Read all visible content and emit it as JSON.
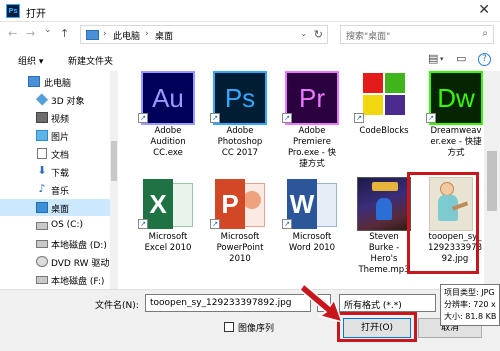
{
  "window": {
    "title": "打开",
    "app_icon_text": "Ps"
  },
  "nav": {
    "back": "←",
    "forward": "→",
    "recent": "⌄",
    "up": "↑",
    "crumbs": [
      "此电脑",
      "桌面"
    ],
    "search_placeholder": "搜索\"桌面\""
  },
  "toolbar": {
    "organize": "组织 ▾",
    "new_folder": "新建文件夹"
  },
  "sidebar": {
    "items": [
      {
        "label": "此电脑",
        "icon": "pc-icon"
      },
      {
        "label": "3D 对象",
        "icon": "cube-icon"
      },
      {
        "label": "视频",
        "icon": "video-icon"
      },
      {
        "label": "图片",
        "icon": "picture-icon"
      },
      {
        "label": "文档",
        "icon": "document-icon"
      },
      {
        "label": "下载",
        "icon": "download-icon"
      },
      {
        "label": "音乐",
        "icon": "music-icon"
      },
      {
        "label": "桌面",
        "icon": "desktop-icon"
      },
      {
        "label": "OS (C:)",
        "icon": "drive-icon"
      },
      {
        "label": "本地磁盘 (D:)",
        "icon": "drive-icon"
      },
      {
        "label": "DVD RW 驱动",
        "icon": "dvd-icon"
      },
      {
        "label": "本地磁盘 (F:)",
        "icon": "drive-icon"
      }
    ]
  },
  "files": [
    {
      "name": "Adobe Audition CC.exe",
      "lines": [
        "Adobe",
        "Audition",
        "CC.exe"
      ],
      "icon_text": "Au"
    },
    {
      "name": "Adobe Photoshop CC 2017",
      "lines": [
        "Adobe",
        "Photoshop",
        "CC 2017"
      ],
      "icon_text": "Ps"
    },
    {
      "name": "Adobe Premiere Pro.exe - 快捷方式",
      "lines": [
        "Adobe",
        "Premiere",
        "Pro.exe - 快",
        "捷方式"
      ],
      "icon_text": "Pr"
    },
    {
      "name": "CodeBlocks",
      "lines": [
        "CodeBlocks"
      ],
      "icon_text": ""
    },
    {
      "name": "Dreamweaver.exe - 快捷方式",
      "lines": [
        "Dreamweav",
        "er.exe - 快捷",
        "方式"
      ],
      "icon_text": "Dw"
    },
    {
      "name": "Microsoft Excel 2010",
      "lines": [
        "Microsoft",
        "Excel 2010"
      ],
      "icon_text": "X"
    },
    {
      "name": "Microsoft PowerPoint 2010",
      "lines": [
        "Microsoft",
        "PowerPoint",
        "2010"
      ],
      "icon_text": "P"
    },
    {
      "name": "Microsoft Word 2010",
      "lines": [
        "Microsoft",
        "Word 2010"
      ],
      "icon_text": "W"
    },
    {
      "name": "Steven Burke - Hero's Theme.mp3",
      "lines": [
        "Steven",
        "Burke -",
        "Hero's",
        "Theme.mp3"
      ],
      "icon_text": ""
    },
    {
      "name": "tooopen_sy_129233397892.jpg",
      "lines": [
        "tooopen_sy_",
        "1292333978",
        "92.jpg"
      ],
      "icon_text": ""
    }
  ],
  "bottom": {
    "filename_label": "文件名(N):",
    "filename_value": "tooopen_sy_129233397892.jpg",
    "filetype_value": "所有格式 (*.*)",
    "sequence_label": "图像序列",
    "open_label": "打开(O)",
    "cancel_label": "取消"
  },
  "tooltip": {
    "lines": [
      "项目类型: JPG",
      "分辨率: 720 x",
      "大小: 81.8 KB"
    ]
  },
  "colors": {
    "highlight": "#c8161d",
    "selection": "#cce8ff",
    "au": "#00005b",
    "ps": "#001d34",
    "pr": "#2a003f",
    "dw": "#35fa00",
    "excel": "#1f7244",
    "powerpoint": "#d24726",
    "word": "#2b579a"
  }
}
